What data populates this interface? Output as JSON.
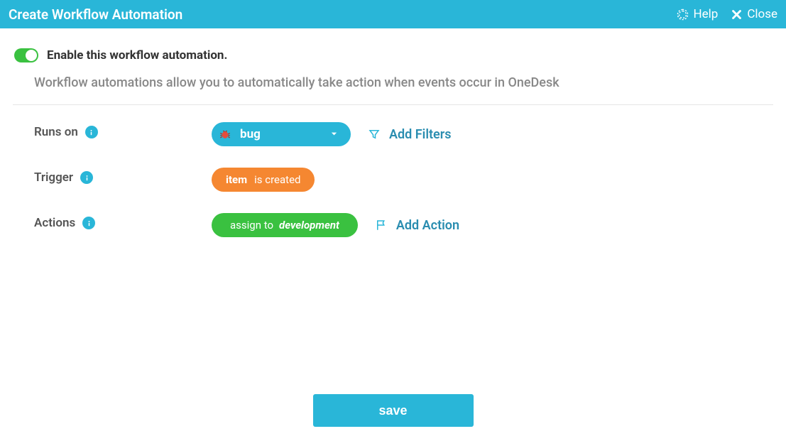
{
  "header": {
    "title": "Create Workflow Automation",
    "help": "Help",
    "close": "Close"
  },
  "enable": {
    "label": "Enable this workflow automation."
  },
  "description": "Workflow automations allow you to automatically take action when events occur in OneDesk",
  "runs_on": {
    "label": "Runs on",
    "value": "bug",
    "add_filters": "Add Filters"
  },
  "trigger": {
    "label": "Trigger",
    "subject": "item",
    "predicate": "is created"
  },
  "actions": {
    "label": "Actions",
    "verb": "assign to",
    "value": "development",
    "add_action": "Add Action"
  },
  "footer": {
    "save": "save"
  }
}
